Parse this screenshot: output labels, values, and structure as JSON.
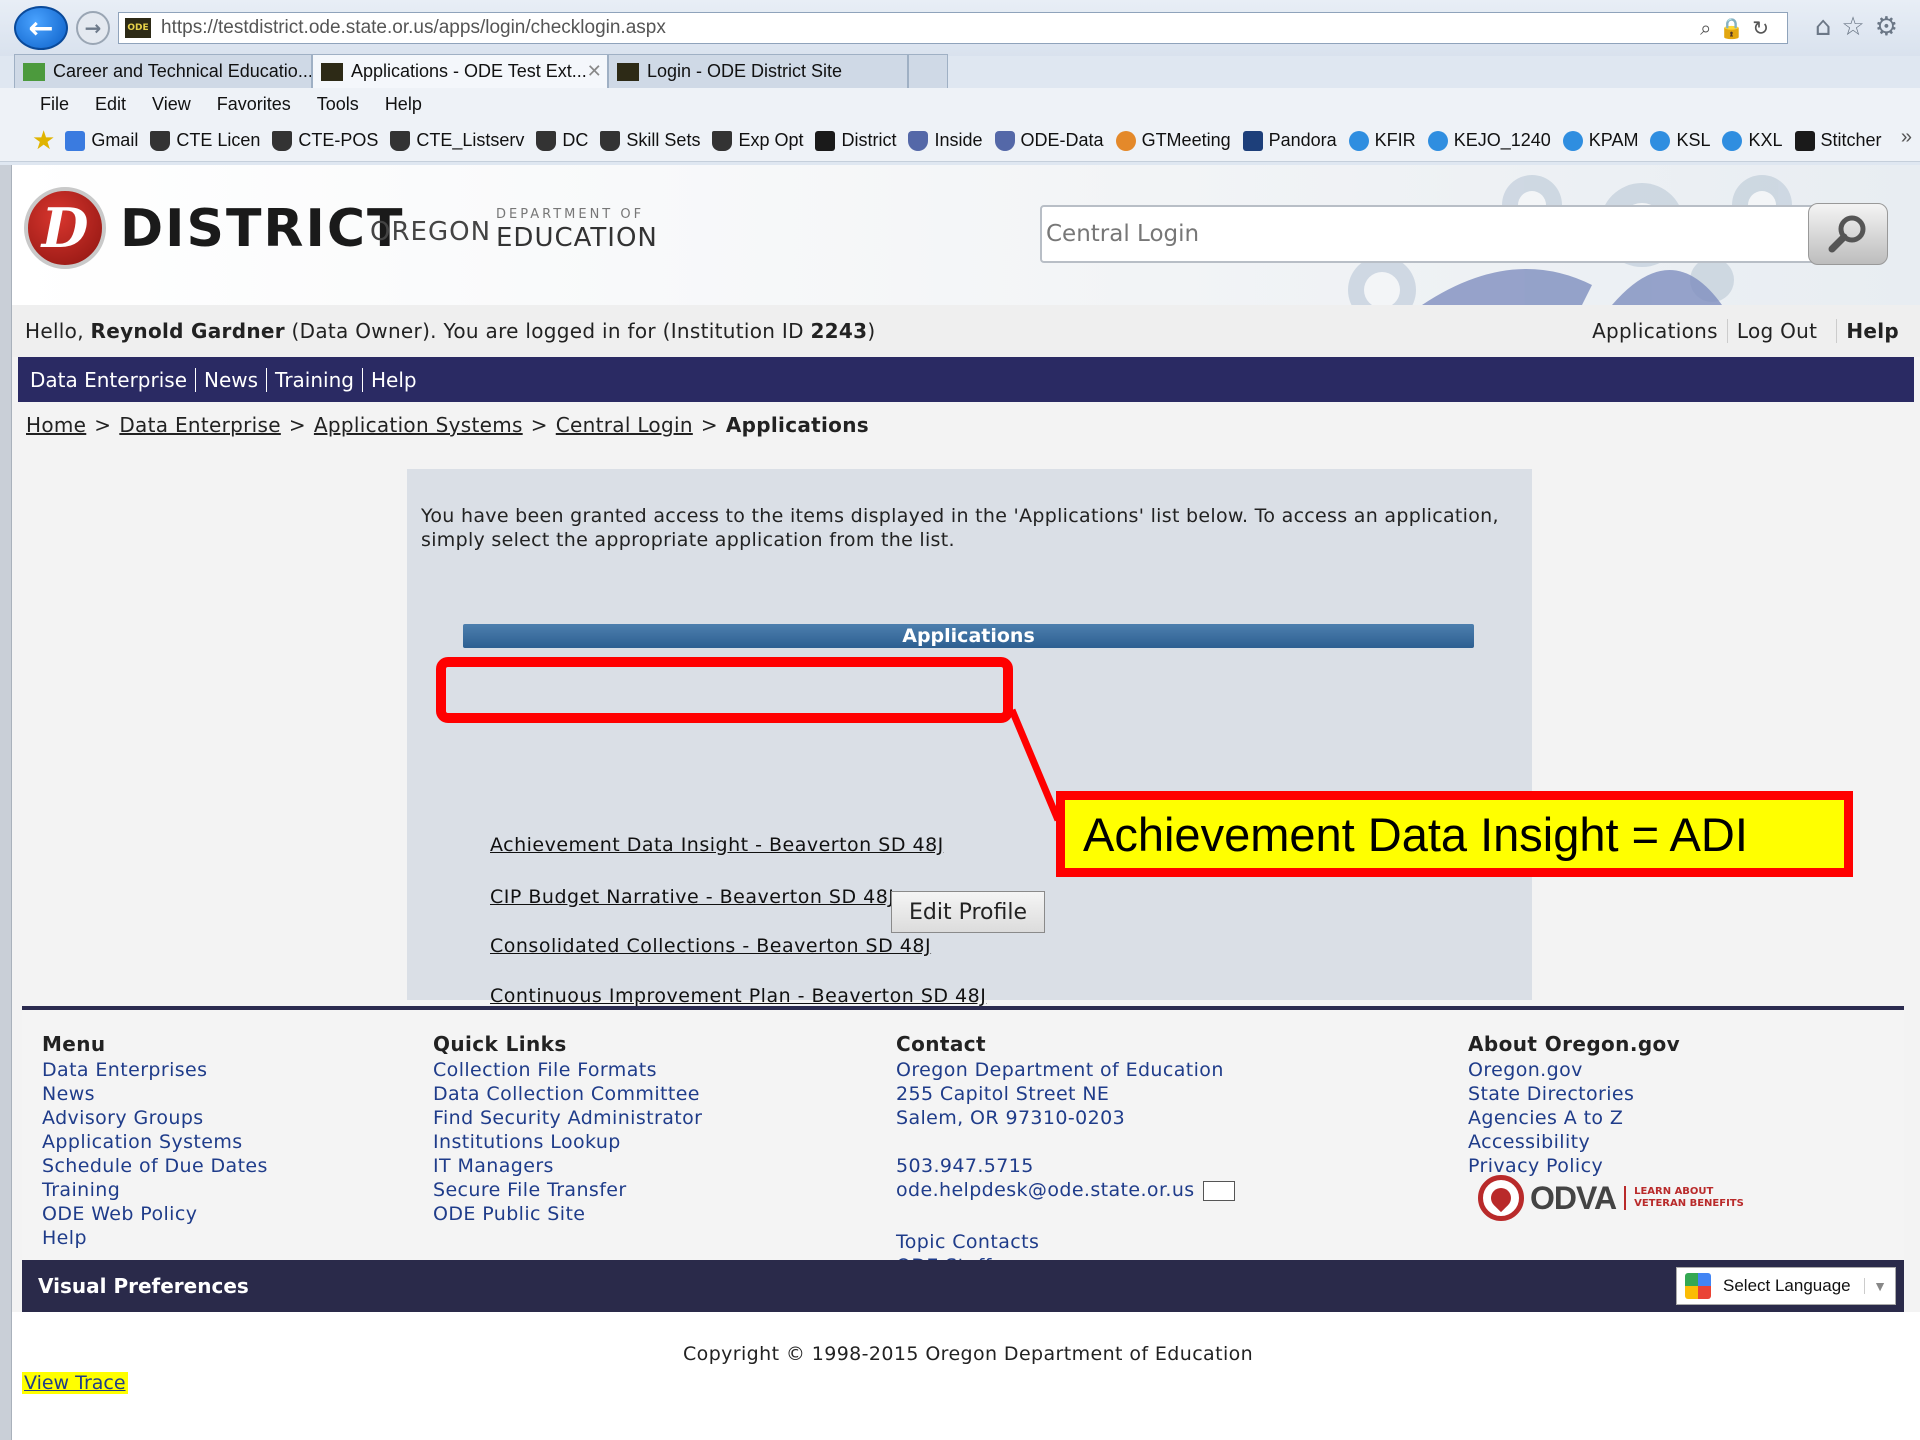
{
  "browser": {
    "url": "https://testdistrict.ode.state.or.us/apps/login/checklogin.aspx",
    "tabs": [
      {
        "label": "Career and Technical Educatio..."
      },
      {
        "label": "Applications - ODE Test Ext..."
      },
      {
        "label": "Login - ODE District Site"
      }
    ],
    "menu": [
      "File",
      "Edit",
      "View",
      "Favorites",
      "Tools",
      "Help"
    ],
    "favorites": [
      {
        "label": "Gmail",
        "icon": "google-icon"
      },
      {
        "label": "CTE Licen",
        "icon": "ode-hat-icon"
      },
      {
        "label": "CTE-POS",
        "icon": "ode-hat-icon"
      },
      {
        "label": "CTE_Listserv",
        "icon": "ode-hat-icon"
      },
      {
        "label": "DC",
        "icon": "ode-hat-icon"
      },
      {
        "label": "Skill Sets",
        "icon": "ode-hat-icon"
      },
      {
        "label": "Exp Opt",
        "icon": "ode-hat-icon"
      },
      {
        "label": "District",
        "icon": "district-icon"
      },
      {
        "label": "Inside",
        "icon": "shield-icon"
      },
      {
        "label": "ODE-Data",
        "icon": "shield-icon"
      },
      {
        "label": "GTMeeting",
        "icon": "gotomeeting-icon"
      },
      {
        "label": "Pandora",
        "icon": "pandora-icon"
      },
      {
        "label": "KFIR",
        "icon": "ie-icon"
      },
      {
        "label": "KEJO_1240",
        "icon": "ie-icon"
      },
      {
        "label": "KPAM",
        "icon": "ie-icon"
      },
      {
        "label": "KSL",
        "icon": "ie-icon"
      },
      {
        "label": "KXL",
        "icon": "ie-icon"
      },
      {
        "label": "Stitcher",
        "icon": "stitcher-icon"
      }
    ]
  },
  "header": {
    "logo_letter": "D",
    "logo_district": "DISTRICT",
    "logo_oregon": "OREGON",
    "logo_dept": "DEPARTMENT OF",
    "logo_education": "EDUCATION",
    "search_placeholder": "Central Login"
  },
  "hello": {
    "prefix": "Hello, ",
    "name": "Reynold Gardner",
    "middle": " (Data Owner). You are logged in for (Institution ID ",
    "institution_id": "2243",
    "suffix": ")"
  },
  "top_links": {
    "applications": "Applications",
    "logout": "Log Out",
    "help": "Help"
  },
  "nav": [
    "Data Enterprise",
    "News",
    "Training",
    "Help"
  ],
  "breadcrumb": {
    "items": [
      "Home",
      "Data Enterprise",
      "Application Systems",
      "Central Login"
    ],
    "current": "Applications",
    "separator": ">"
  },
  "main": {
    "intro_line1": "You have been granted access to the items displayed in the 'Applications' list below.  To access an application,",
    "intro_line2": "simply select the appropriate application from the list.",
    "apps_header": "Applications",
    "apps": [
      "Achievement Data Insight - Beaverton SD 48J",
      "CIP Budget Narrative - Beaverton SD 48J",
      "Consolidated Collections - Beaverton SD 48J",
      "Continuous Improvement Plan - Beaverton SD 48J"
    ],
    "edit_profile": "Edit Profile"
  },
  "annotation": {
    "callout": "Achievement Data Insight = ADI",
    "color": "#ff0000",
    "fill": "#ffff00"
  },
  "footer": {
    "menu": {
      "title": "Menu",
      "items": [
        "Data Enterprises",
        "News",
        "Advisory Groups",
        "Application Systems",
        "Schedule of Due Dates",
        "Training",
        "ODE Web Policy",
        "Help"
      ]
    },
    "quick_links": {
      "title": "Quick Links",
      "items": [
        "Collection File Formats",
        "Data Collection Committee",
        "Find Security Administrator",
        "Institutions Lookup",
        "IT Managers",
        "Secure File Transfer",
        "ODE Public Site"
      ]
    },
    "contact": {
      "title": "Contact",
      "org": "Oregon Department of Education",
      "street": "255 Capitol Street NE",
      "city": "Salem, OR 97310-0203",
      "phone": "503.947.5715",
      "email": "ode.helpdesk@ode.state.or.us",
      "topic_contacts": "Topic Contacts",
      "staff": "ODE Staff"
    },
    "about": {
      "title": "About Oregon.gov",
      "items": [
        "Oregon.gov",
        "State Directories",
        "Agencies A to Z",
        "Accessibility",
        "Privacy Policy"
      ]
    },
    "odva": {
      "name": "ODVA",
      "tagline": "LEARN ABOUT VETERAN BENEFITS"
    }
  },
  "visual_prefs": {
    "label": "Visual Preferences",
    "language": "Select Language"
  },
  "copyright": "Copyright © 1998-2015 Oregon Department of Education",
  "view_trace": "View Trace"
}
